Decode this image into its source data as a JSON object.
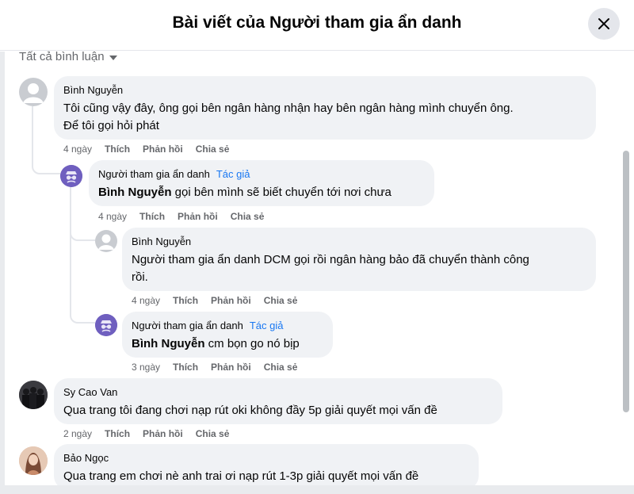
{
  "dialog": {
    "title": "Bài viết của Người tham gia ẩn danh"
  },
  "filter": {
    "label": "Tất cả bình luận"
  },
  "actions": {
    "like": "Thích",
    "reply": "Phản hồi",
    "share": "Chia sẻ"
  },
  "comments": [
    {
      "author": "Bình Nguyễn",
      "badge": "",
      "mention": "",
      "text_lines": [
        "Tôi cũng vậy đây, ông gọi bên ngân hàng nhận hay bên ngân hàng mình chuyển ông.",
        "Để tôi gọi hỏi phát"
      ],
      "time": "4 ngày",
      "avatar": "default-avatar-icon"
    },
    {
      "author": "Người tham gia ẩn danh",
      "badge": "Tác giả",
      "mention": "Bình Nguyễn",
      "text_lines": [
        " gọi bên mình sẽ biết chuyển tới nơi chưa"
      ],
      "time": "4 ngày",
      "avatar": "anonymous-avatar-icon"
    },
    {
      "author": "Bình Nguyễn",
      "badge": "",
      "mention": "",
      "text_lines": [
        "Người tham gia ẩn danh DCM gọi rồi ngân hàng bảo đã chuyển thành công",
        "rồi."
      ],
      "time": "4 ngày",
      "avatar": "default-avatar-icon"
    },
    {
      "author": "Người tham gia ẩn danh",
      "badge": "Tác giả",
      "mention": "Bình Nguyễn",
      "text_lines": [
        " cm bọn go nó bịp"
      ],
      "time": "3 ngày",
      "avatar": "anonymous-avatar-icon"
    },
    {
      "author": "Sy Cao Van",
      "badge": "",
      "mention": "",
      "text_lines": [
        "Qua trang tôi đang chơi nạp rút oki không đầy 5p giải quyết mọi vấn đề"
      ],
      "time": "2 ngày",
      "avatar": "user-photo-avatar"
    },
    {
      "author": "Bảo Ngọc",
      "badge": "",
      "mention": "",
      "text_lines": [
        "Qua trang em chơi nè anh trai ơi nạp rút 1-3p giải quyết mọi vấn đề"
      ],
      "time": "",
      "avatar": "user-photo-avatar"
    }
  ],
  "colors": {
    "bubble": "#f0f2f5",
    "link_blue": "#1877f2",
    "muted": "#65676b",
    "anon_avatar": "#6f5fbf"
  }
}
